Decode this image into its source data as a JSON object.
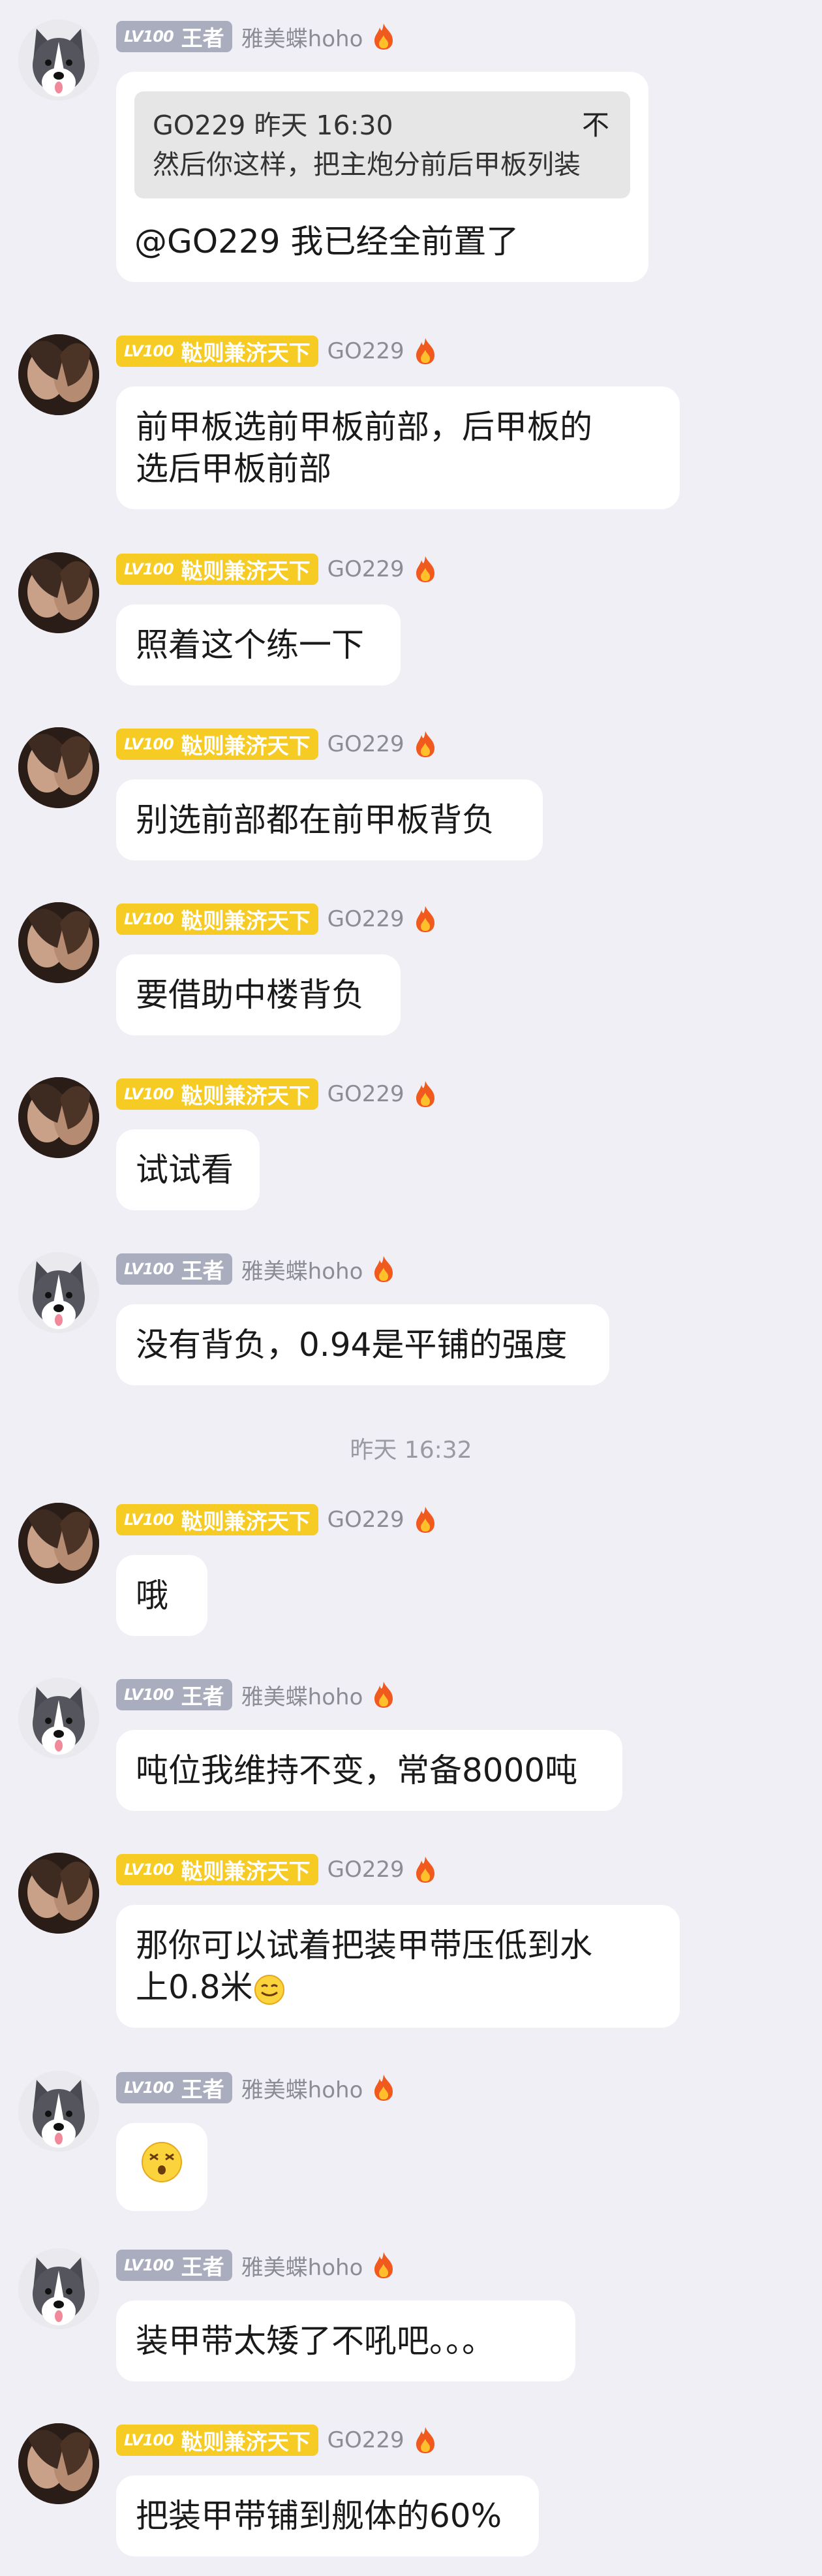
{
  "messages": [
    {
      "avatar": "husky",
      "level": "LV100",
      "title": "王者",
      "name": "雅美蝶hoho",
      "quote": {
        "author": "GO229",
        "time": "昨天 16:30",
        "text": "然后你这样，把主炮分前后甲板列装",
        "close": "不"
      },
      "text": "@GO229 我已经全前置了"
    },
    {
      "avatar": "couple",
      "level": "LV100",
      "title": "鞑则兼济天下",
      "name": "GO229",
      "text": "前甲板选前甲板前部，后甲板的"
    },
    {
      "avatar": "couple",
      "level": "LV100",
      "title": "鞑则兼济天下",
      "name": "GO229",
      "text": "照着这个练一下"
    },
    {
      "avatar": "couple",
      "level": "LV100",
      "title": "鞑则兼济天下",
      "name": "GO229",
      "text": "别选前部都在前甲板背负"
    },
    {
      "avatar": "couple",
      "level": "LV100",
      "title": "鞑则兼济天下",
      "name": "GO229",
      "text": "要借助中楼背负"
    },
    {
      "avatar": "couple",
      "level": "LV100",
      "title": "鞑则兼济天下",
      "name": "GO229",
      "text": "试试看"
    },
    {
      "avatar": "husky",
      "level": "LV100",
      "title": "王者",
      "name": "雅美蝶hoho",
      "text": "没有背负，0.94是平铺的强度"
    },
    {
      "avatar": "couple",
      "level": "LV100",
      "title": "鞑则兼济天下",
      "name": "GO229",
      "text": "哦"
    },
    {
      "avatar": "husky",
      "level": "LV100",
      "title": "王者",
      "name": "雅美蝶hoho",
      "text": "吨位我维持不变，常备8000吨"
    },
    {
      "avatar": "couple",
      "level": "LV100",
      "title": "鞑则兼济天下",
      "name": "GO229",
      "text": "那你可以试着把装甲带压低到水"
    },
    {
      "avatar": "husky",
      "level": "LV100",
      "title": "王者",
      "name": "雅美蝶hoho",
      "emoji": "dizzy-face-emoji"
    },
    {
      "avatar": "husky",
      "level": "LV100",
      "title": "王者",
      "name": "雅美蝶hoho",
      "text": "装甲带太矮了不吼吧。。。"
    },
    {
      "avatar": "couple",
      "level": "LV100",
      "title": "鞑则兼济天下",
      "name": "GO229",
      "text": "把装甲带铺到舰体的60%"
    }
  ],
  "m1_line2": "选后甲板前部",
  "m9_line2": "上0.8米",
  "m9_emoji": "smile-emoji",
  "timestamp": "昨天 16:32",
  "colors": {
    "background": "#efeff5",
    "bubble": "#ffffff",
    "badge_gray": "#a9adbe",
    "badge_gold": "#f6cb24",
    "name": "#8c8c96"
  }
}
